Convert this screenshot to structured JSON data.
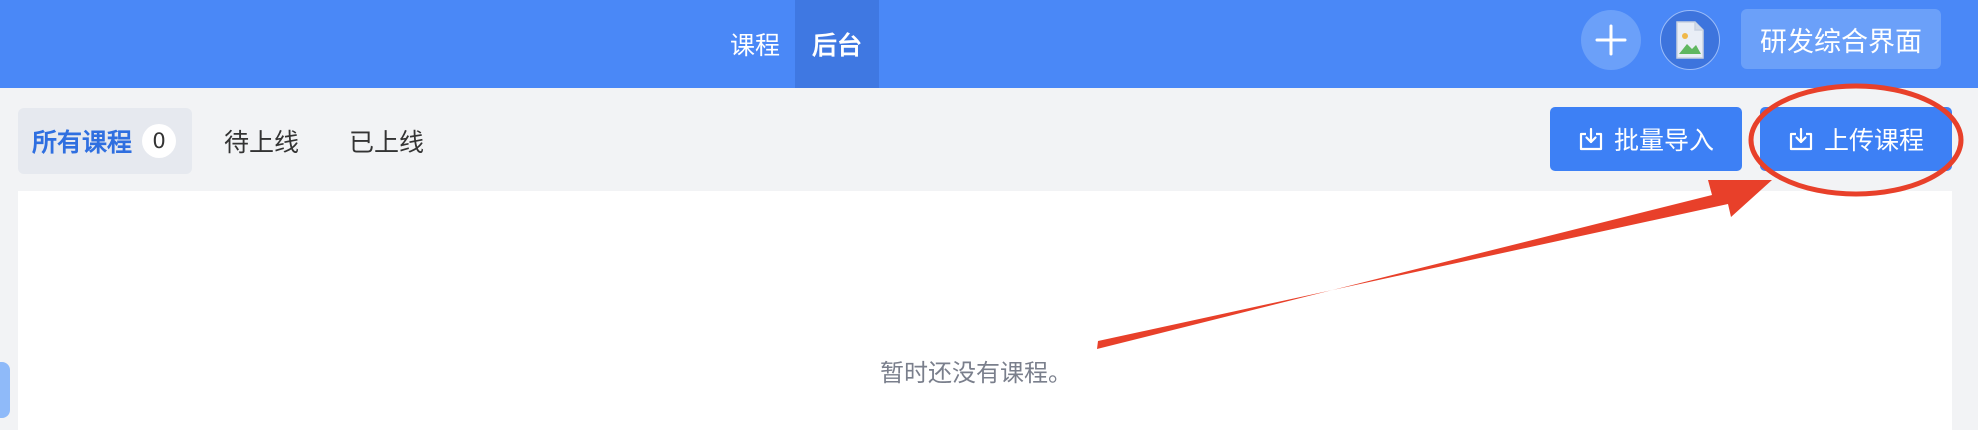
{
  "header": {
    "nav": [
      {
        "label": "课程"
      },
      {
        "label": "后台"
      }
    ],
    "workspace_button": "研发综合界面"
  },
  "toolbar": {
    "tabs": {
      "all": {
        "label": "所有课程",
        "count": "0"
      },
      "pending": {
        "label": "待上线"
      },
      "online": {
        "label": "已上线"
      }
    },
    "import_button": "批量导入",
    "upload_button": "上传课程"
  },
  "main": {
    "empty_message": "暂时还没有课程。"
  },
  "icons": {
    "add": "plus-icon",
    "avatar": "broken-image-icon",
    "import": "download-tray-icon",
    "upload": "download-tray-icon"
  },
  "colors": {
    "header_bg": "#4a88f7",
    "primary": "#3d80f5",
    "annotation": "#e8402a"
  }
}
